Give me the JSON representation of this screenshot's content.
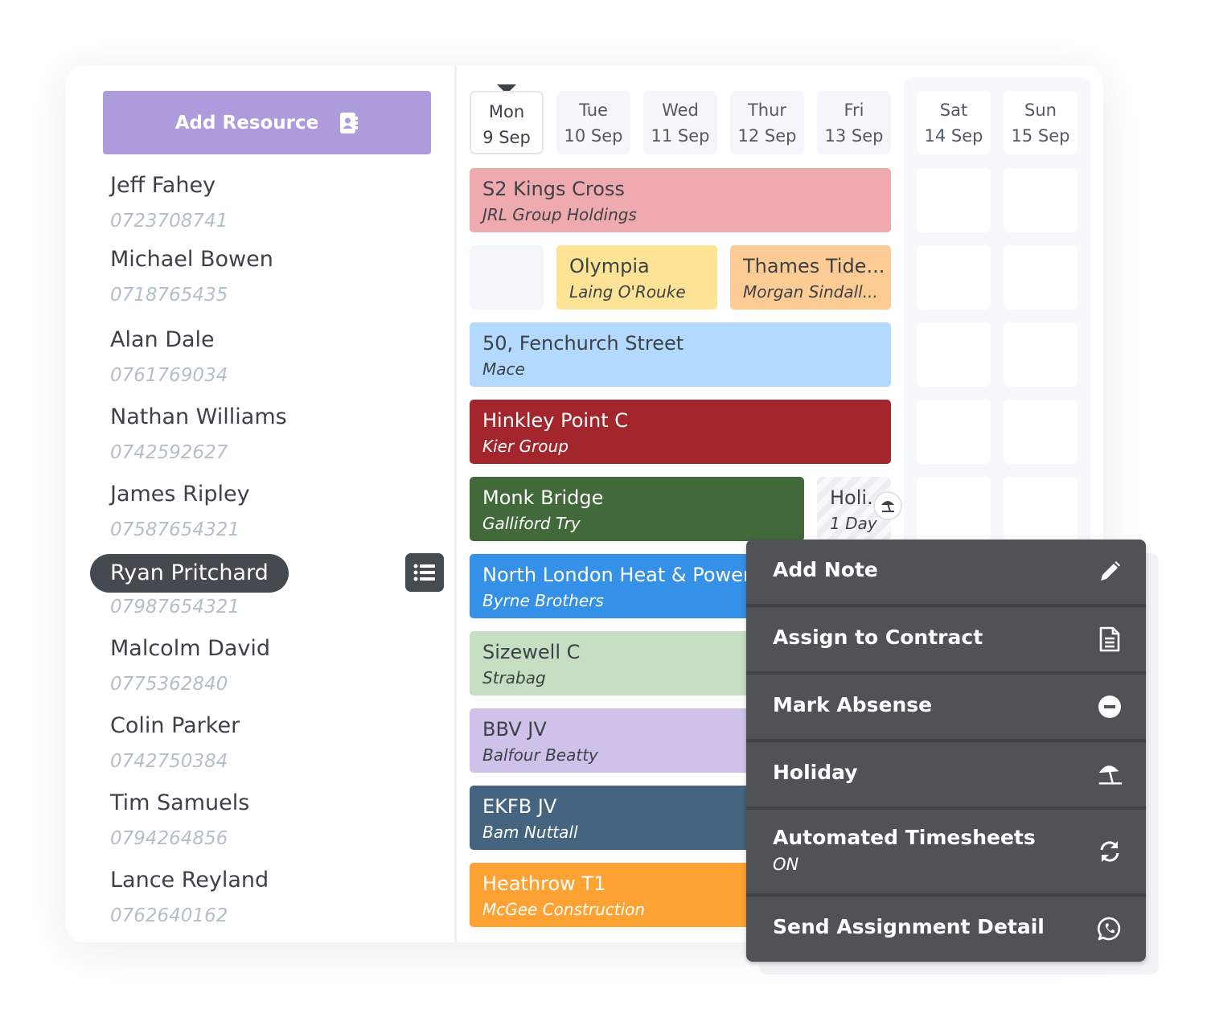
{
  "sidebar": {
    "add_resource_label": "Add Resource",
    "people": [
      {
        "name": "Jeff Fahey",
        "phone": "0723708741"
      },
      {
        "name": "Michael Bowen",
        "phone": "0718765435"
      },
      {
        "name": "Alan Dale",
        "phone": "0761769034"
      },
      {
        "name": "Nathan Williams",
        "phone": "0742592627"
      },
      {
        "name": "James Ripley",
        "phone": "07587654321"
      },
      {
        "name": "Ryan Pritchard",
        "phone": "07987654321",
        "selected": true
      },
      {
        "name": "Malcolm David",
        "phone": "0775362840"
      },
      {
        "name": "Colin Parker",
        "phone": "0742750384"
      },
      {
        "name": "Tim Samuels",
        "phone": "0794264856"
      },
      {
        "name": "Lance Reyland",
        "phone": "0762640162"
      }
    ]
  },
  "week": {
    "days": [
      {
        "day": "Mon",
        "date": "9 Sep",
        "today": true
      },
      {
        "day": "Tue",
        "date": "10 Sep"
      },
      {
        "day": "Wed",
        "date": "11 Sep"
      },
      {
        "day": "Thur",
        "date": "12 Sep"
      },
      {
        "day": "Fri",
        "date": "13 Sep"
      },
      {
        "day": "Sat",
        "date": "14 Sep"
      },
      {
        "day": "Sun",
        "date": "15 Sep"
      }
    ]
  },
  "assignments": {
    "row1": {
      "title": "S2 Kings Cross",
      "client": "JRL Group Holdings",
      "color": "#eeaaae"
    },
    "row2a": {
      "title": "Olympia",
      "client": "Laing O'Rouke",
      "color": "#fde395"
    },
    "row2b": {
      "title": "Thames Tide...",
      "client": "Morgan Sindall...",
      "color": "#fdcc94"
    },
    "row3": {
      "title": "50, Fenchurch Street",
      "client": "Mace",
      "color": "#b3dafe"
    },
    "row4": {
      "title": "Hinkley Point C",
      "client": "Kier Group",
      "color": "#a3262c"
    },
    "row5": {
      "title": "Monk Bridge",
      "client": "Galliford Try",
      "color": "#42693a"
    },
    "row5_holiday": {
      "title": "Holi.",
      "duration": "1 Day"
    },
    "row6": {
      "title": "North London Heat & Power",
      "client": "Byrne Brothers",
      "color": "#3590e7"
    },
    "row7": {
      "title": "Sizewell C",
      "client": "Strabag",
      "color": "#c6dfc2"
    },
    "row8": {
      "title": "BBV JV",
      "client": "Balfour Beatty",
      "color": "#cfc1ea"
    },
    "row9": {
      "title": "EKFB JV",
      "client": "Bam Nuttall",
      "color": "#44647f"
    },
    "row10": {
      "title": "Heathrow T1",
      "client": "McGee Construction",
      "color": "#fda233"
    }
  },
  "context_menu": {
    "items": [
      {
        "label": "Add Note",
        "icon": "pencil-icon"
      },
      {
        "label": "Assign to Contract",
        "icon": "document-icon"
      },
      {
        "label": "Mark Absense",
        "icon": "minus-circle-icon"
      },
      {
        "label": "Holiday",
        "icon": "beach-umbrella-icon"
      },
      {
        "label": "Automated Timesheets",
        "sub": "ON",
        "icon": "sync-icon"
      },
      {
        "label": "Send Assignment Detail",
        "icon": "whatsapp-icon"
      }
    ]
  }
}
